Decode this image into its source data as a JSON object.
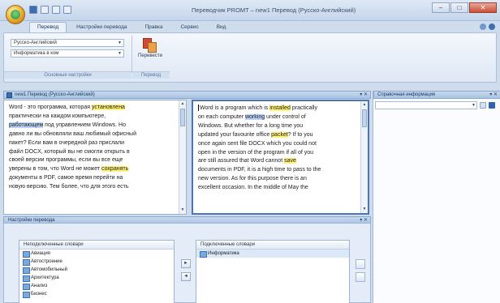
{
  "window": {
    "title": "Переводчик PROMT – new1 Перевод (Русско-Английский)",
    "controls": {
      "minimize": "–",
      "maximize": "□",
      "close": "✕"
    }
  },
  "ribbon": {
    "tabs": [
      {
        "label": "Перевод",
        "active": true
      },
      {
        "label": "Настройки перевода",
        "active": false
      },
      {
        "label": "Правка",
        "active": false
      },
      {
        "label": "Сервис",
        "active": false
      },
      {
        "label": "Вид",
        "active": false
      }
    ],
    "direction_combo": "Русско-Английский",
    "subject_combo": "Информатика в ком",
    "group_settings_label": "Основные настройки",
    "translate_button": "Перевести",
    "group_translate_label": "Перевод"
  },
  "source_pane": {
    "header": "new1 Перевод (Русско-Английский)",
    "lines": [
      [
        {
          "t": "Word - это программа, которая "
        },
        {
          "t": "установлена",
          "c": "hl-y"
        }
      ],
      [
        {
          "t": "практически на каждом компьютере,"
        }
      ],
      [
        {
          "t": "работающем",
          "c": "hl-b"
        },
        {
          "t": " под управлением Windows. Но"
        }
      ],
      [
        {
          "t": "давно ли вы обновляли ваш любимый офисный"
        }
      ],
      [
        {
          "t": "пакет? Если вам в очередной раз прислали"
        }
      ],
      [
        {
          "t": "файл DOCX, который вы не смогли открыть в"
        }
      ],
      [
        {
          "t": "своей версии программы, если вы все еще"
        }
      ],
      [
        {
          "t": "уверены в том, что Word не может "
        },
        {
          "t": "сохранять",
          "c": "hl-y"
        }
      ],
      [
        {
          "t": "документы в PDF, самое время перейти на"
        }
      ],
      [
        {
          "t": "новую версию. Тем более, что для этого есть"
        }
      ]
    ]
  },
  "target_pane": {
    "lines": [
      [
        {
          "t": "Word is a program which is "
        },
        {
          "t": "installed",
          "c": "hl-y"
        },
        {
          "t": " practically"
        }
      ],
      [
        {
          "t": "on each computer "
        },
        {
          "t": "working",
          "c": "hl-b"
        },
        {
          "t": " under control of"
        }
      ],
      [
        {
          "t": "Windows. But whether for a long time you"
        }
      ],
      [
        {
          "t": "updated your favourite office "
        },
        {
          "t": "packet",
          "c": "hl-y"
        },
        {
          "t": "? If to you"
        }
      ],
      [
        {
          "t": "once again sent file DOCX which you could not"
        }
      ],
      [
        {
          "t": "open in the version of the program if all of you"
        }
      ],
      [
        {
          "t": "are still assured that Word cannot "
        },
        {
          "t": "save",
          "c": "hl-y"
        }
      ],
      [
        {
          "t": "documents in PDF, it is a high time to pass to the"
        }
      ],
      [
        {
          "t": "new version. As for this purpose there is an"
        }
      ],
      [
        {
          "t": "excellent occasion. In the middle of May the"
        }
      ]
    ]
  },
  "reference_pane": {
    "header": "Справочная информация"
  },
  "settings_pane": {
    "header": "Настройки перевода",
    "available_header": "Неподключенные словари",
    "available_items": [
      "Авиация",
      "Автостроение",
      "Автомобильный",
      "Архитектура",
      "Анализ",
      "Бизнес"
    ],
    "connected_header": "Подключенные словари",
    "connected_items": [
      "Информатика"
    ],
    "add_arrow": "►",
    "remove_arrow": "◄"
  },
  "colors": {
    "highlight_yellow": "#fff27a",
    "highlight_blue": "#b8d3f7",
    "ribbon_blue": "#cfdcec"
  }
}
